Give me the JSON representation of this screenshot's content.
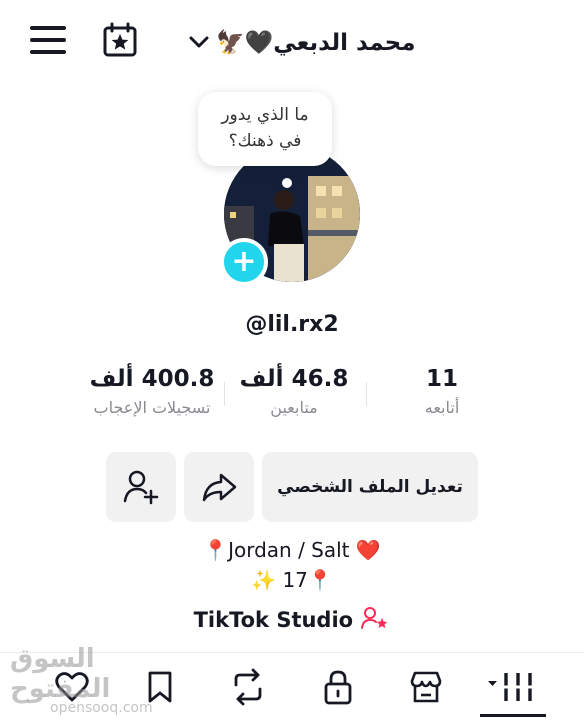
{
  "header": {
    "title": "محمد الدبعي🖤🦅",
    "menu_icon": "hamburger-menu-icon",
    "calendar_icon": "calendar-star-icon",
    "dropdown_icon": "chevron-down-icon"
  },
  "thought_bubble": {
    "line1": "ما الذي يدور",
    "line2": "في ذهنك؟"
  },
  "profile": {
    "username": "@lil.rx2"
  },
  "stats": [
    {
      "value": "11",
      "label": "أتابعه"
    },
    {
      "value": "46.8 ألف",
      "label": "متابعين"
    },
    {
      "value": "400.8 ألف",
      "label": "تسجيلات الإعجاب"
    }
  ],
  "actions": {
    "edit_profile": "تعديل الملف الشخصي"
  },
  "bio": {
    "line1": "📍Jordan / Salt ❤️",
    "line2": "✨ 17📍"
  },
  "studio": {
    "label": "TikTok Studio"
  },
  "tabs": [
    "videos-grid-icon",
    "shop-icon",
    "private-lock-icon",
    "reposts-icon",
    "favorites-icon",
    "liked-icon"
  ],
  "watermark": {
    "main": "السوق المفتوح",
    "sub": "opensooq.com"
  },
  "colors": {
    "accent": "#20d5ec",
    "star": "#fe2c55",
    "text": "#161823",
    "muted": "#8a8b91",
    "button_bg": "#f1f1f2"
  }
}
